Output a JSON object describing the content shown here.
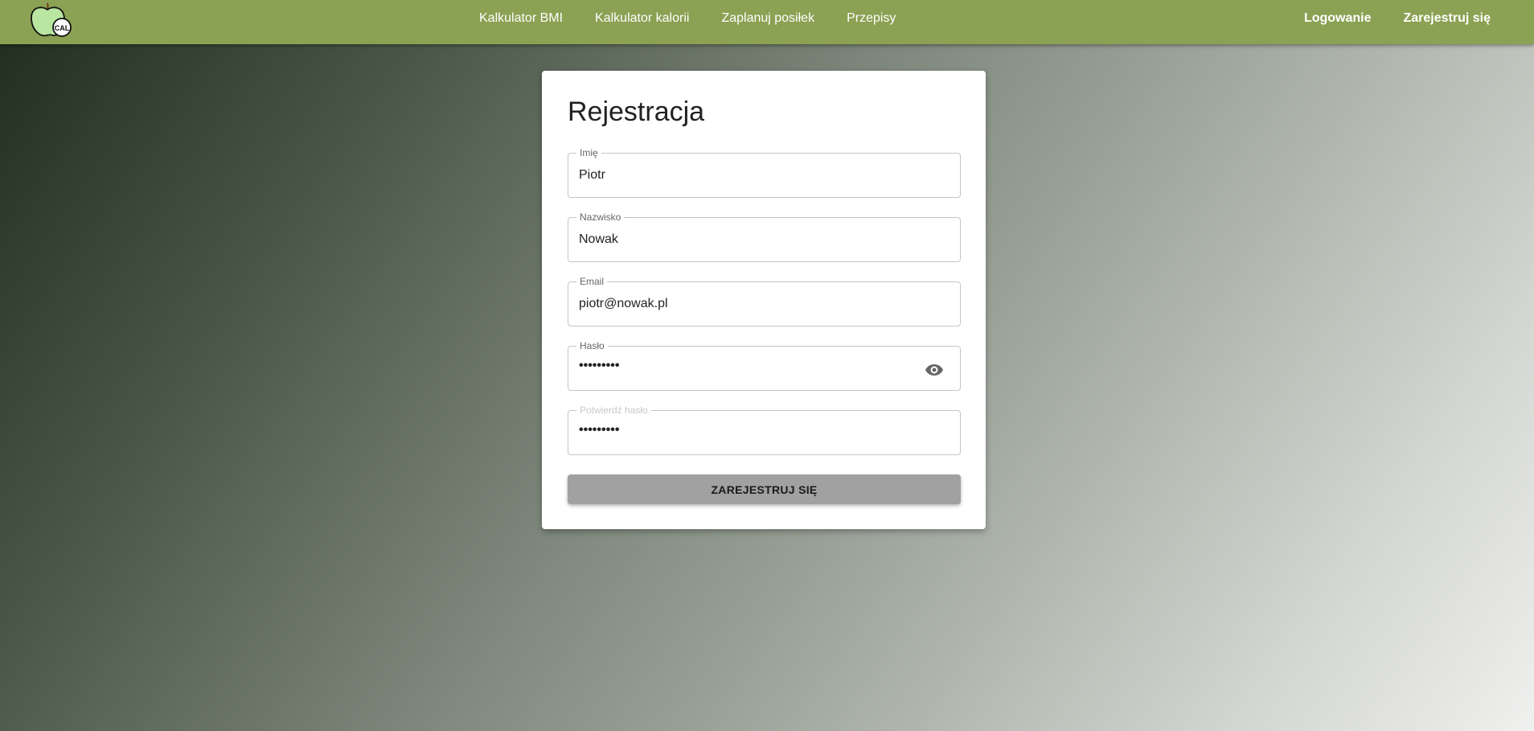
{
  "nav": {
    "logo_text": "CAL",
    "links": [
      "Kalkulator BMI",
      "Kalkulator kalorii",
      "Zaplanuj posiłek",
      "Przepisy"
    ],
    "login": "Logowanie",
    "register": "Zarejestruj się"
  },
  "form": {
    "title": "Rejestracja",
    "first_name": {
      "label": "Imię",
      "value": "Piotr"
    },
    "last_name": {
      "label": "Nazwisko",
      "value": "Nowak"
    },
    "email": {
      "label": "Email",
      "value": "piotr@nowak.pl"
    },
    "password": {
      "label": "Hasło",
      "value": "•••••••••"
    },
    "confirm_password": {
      "label": "Potwierdź hasło",
      "value": "•••••••••"
    },
    "submit": "ZAREJESTRUJ SIĘ"
  },
  "colors": {
    "navbar": "#8ba153",
    "button": "#a1a1a1",
    "logo_apple": "#b9e6a0"
  },
  "icons": [
    "apple-logo-icon",
    "eye-icon"
  ]
}
